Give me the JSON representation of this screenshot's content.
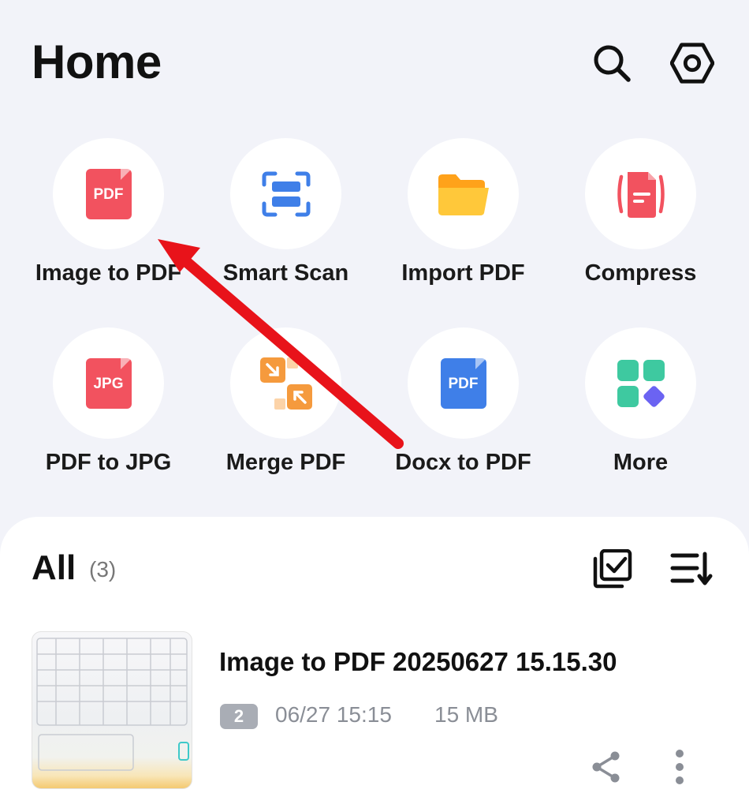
{
  "header": {
    "title": "Home",
    "search_icon": "search-icon",
    "settings_icon": "gear-icon"
  },
  "tools": [
    {
      "label": "Image to PDF",
      "icon": "pdf-file-icon",
      "icon_text": "PDF",
      "color": "#f2525f"
    },
    {
      "label": "Smart Scan",
      "icon": "scan-icon",
      "color": "#3f7fe8"
    },
    {
      "label": "Import PDF",
      "icon": "folder-icon",
      "color": "#ffb422"
    },
    {
      "label": "Compress",
      "icon": "compress-icon",
      "color": "#f2525f"
    },
    {
      "label": "PDF to JPG",
      "icon": "jpg-file-icon",
      "icon_text": "JPG",
      "color": "#f2525f"
    },
    {
      "label": "Merge PDF",
      "icon": "merge-icon",
      "color": "#f5a04a"
    },
    {
      "label": "Docx to PDF",
      "icon": "docx-pdf-icon",
      "icon_text": "PDF",
      "color": "#3f7fe8"
    },
    {
      "label": "More",
      "icon": "grid-more-icon",
      "color": "#3ec9a0"
    }
  ],
  "list": {
    "title": "All",
    "count": "(3)",
    "select_icon": "multi-select-icon",
    "sort_icon": "sort-icon"
  },
  "files": [
    {
      "name": "Image to PDF 20250627 15.15.30",
      "pages": "2",
      "date": "06/27 15:15",
      "size": "15 MB"
    }
  ],
  "annotation": {
    "arrow_color": "#e8131a"
  }
}
